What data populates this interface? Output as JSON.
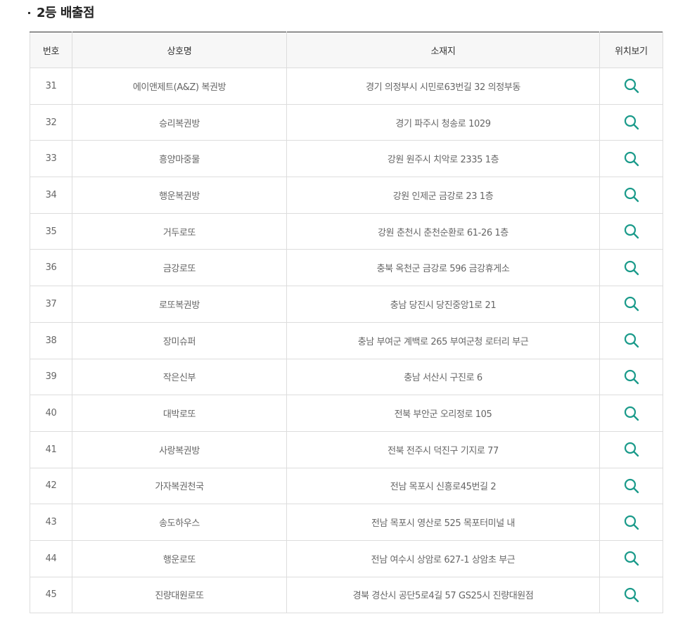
{
  "section": {
    "title": "2등 배출점"
  },
  "table": {
    "headers": {
      "no": "번호",
      "name": "상호명",
      "address": "소재지",
      "location": "위치보기"
    },
    "rows": [
      {
        "no": "31",
        "name": "에이앤제트(A&Z) 복권방",
        "address": "경기 의정부시 시민로63번길 32 의정부동"
      },
      {
        "no": "32",
        "name": "승리복권방",
        "address": "경기 파주시 청송로 1029"
      },
      {
        "no": "33",
        "name": "흥양마중물",
        "address": "강원 원주시 치악로 2335 1층"
      },
      {
        "no": "34",
        "name": "행운복권방",
        "address": "강원 인제군 금강로 23 1층"
      },
      {
        "no": "35",
        "name": "거두로또",
        "address": "강원 춘천시 춘천순환로 61-26 1층"
      },
      {
        "no": "36",
        "name": "금강로또",
        "address": "충북 옥천군 금강로 596 금강휴게소"
      },
      {
        "no": "37",
        "name": "로또복권방",
        "address": "충남 당진시 당진중앙1로 21"
      },
      {
        "no": "38",
        "name": "장미슈퍼",
        "address": "충남 부여군 계백로 265 부여군청 로터리 부근"
      },
      {
        "no": "39",
        "name": "작은신부",
        "address": "충남 서산시 구진로 6"
      },
      {
        "no": "40",
        "name": "대박로또",
        "address": "전북 부안군 오리정로 105"
      },
      {
        "no": "41",
        "name": "사랑복권방",
        "address": "전북 전주시 덕진구 기지로 77"
      },
      {
        "no": "42",
        "name": "가자복권천국",
        "address": "전남 목포시 신흥로45번길 2"
      },
      {
        "no": "43",
        "name": "송도하우스",
        "address": "전남 목포시 영산로 525 목포터미널 내"
      },
      {
        "no": "44",
        "name": "행운로또",
        "address": "전남 여수시 상암로 627-1 상암초 부근"
      },
      {
        "no": "45",
        "name": "진량대원로또",
        "address": "경북 경산시 공단5로4길 57 GS25시 진량대원점"
      }
    ]
  },
  "icons": {
    "map": "search-icon"
  },
  "colors": {
    "icon": "#1a9a8a",
    "header_bg": "#f7f7f7",
    "border": "#dddddd",
    "top_border": "#333333"
  }
}
